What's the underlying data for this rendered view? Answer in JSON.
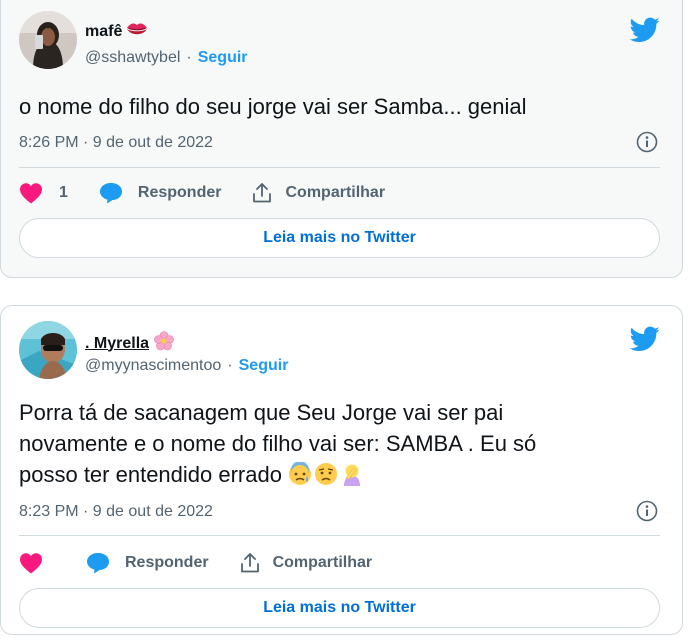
{
  "colors": {
    "accent": "#1d9bf0",
    "like": "#f91880",
    "muted": "#536471",
    "link": "#006fd6"
  },
  "tweets": [
    {
      "name": "mafê",
      "name_emoji": "lips-icon",
      "handle": "@sshawtybel",
      "follow": "Seguir",
      "text": "o nome do filho do seu jorge vai ser Samba... genial",
      "timestamp": "8:26 PM · 9 de out de 2022",
      "likes": "1",
      "reply": "Responder",
      "share": "Compartilhar",
      "more": "Leia mais no Twitter"
    },
    {
      "name": ". Myrella",
      "name_emoji": "cherry-blossom-icon",
      "handle": "@myynascimentoo",
      "follow": "Seguir",
      "text_lines": [
        "Porra tá de sacanagem que Seu Jorge vai ser pai",
        "novamente e o nome do filho vai ser: SAMBA . Eu só",
        "posso ter entendido errado"
      ],
      "text_emojis": [
        "anxious-face-icon",
        "sad-face-icon",
        "facepalm-icon"
      ],
      "timestamp": "8:23 PM · 9 de out de 2022",
      "reply": "Responder",
      "share": "Compartilhar",
      "more": "Leia mais no Twitter"
    }
  ]
}
